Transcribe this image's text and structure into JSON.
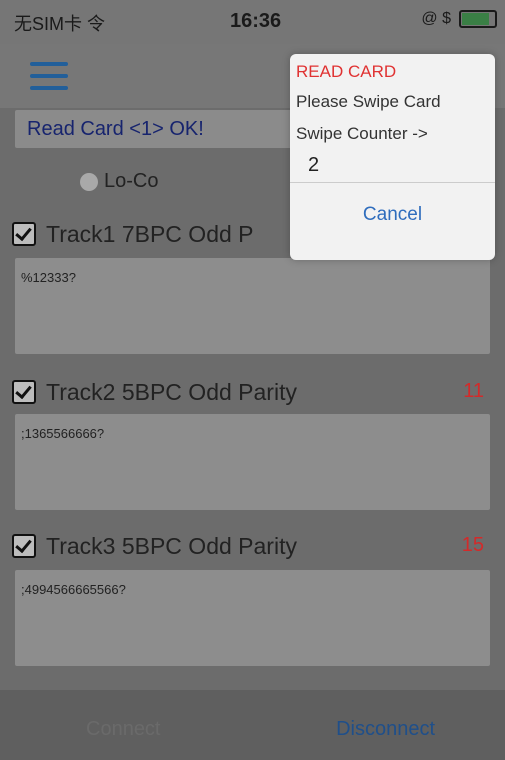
{
  "status_bar": {
    "carrier": "无SIM卡 令",
    "time": "16:36",
    "right_icons": "@ $",
    "battery_level": 0.8
  },
  "main": {
    "read_status": "Read Card <1> OK!",
    "mode_option": "Lo-Co",
    "tracks": [
      {
        "label": "Track1 7BPC Odd P",
        "data": "%12333?"
      },
      {
        "label": "Track2 5BPC Odd Parity",
        "count": "11",
        "data": ";1365566666?"
      },
      {
        "label": "Track3 5BPC Odd Parity",
        "count": "15",
        "data": ";4994566665566?"
      }
    ]
  },
  "bottom_bar": {
    "left_button": "Connect",
    "right_button": "Disconnect"
  },
  "popup": {
    "title": "READ CARD",
    "message": "Please Swipe Card",
    "counter_label": "Swipe Counter ->",
    "counter_value": "2",
    "cancel_label": "Cancel"
  }
}
